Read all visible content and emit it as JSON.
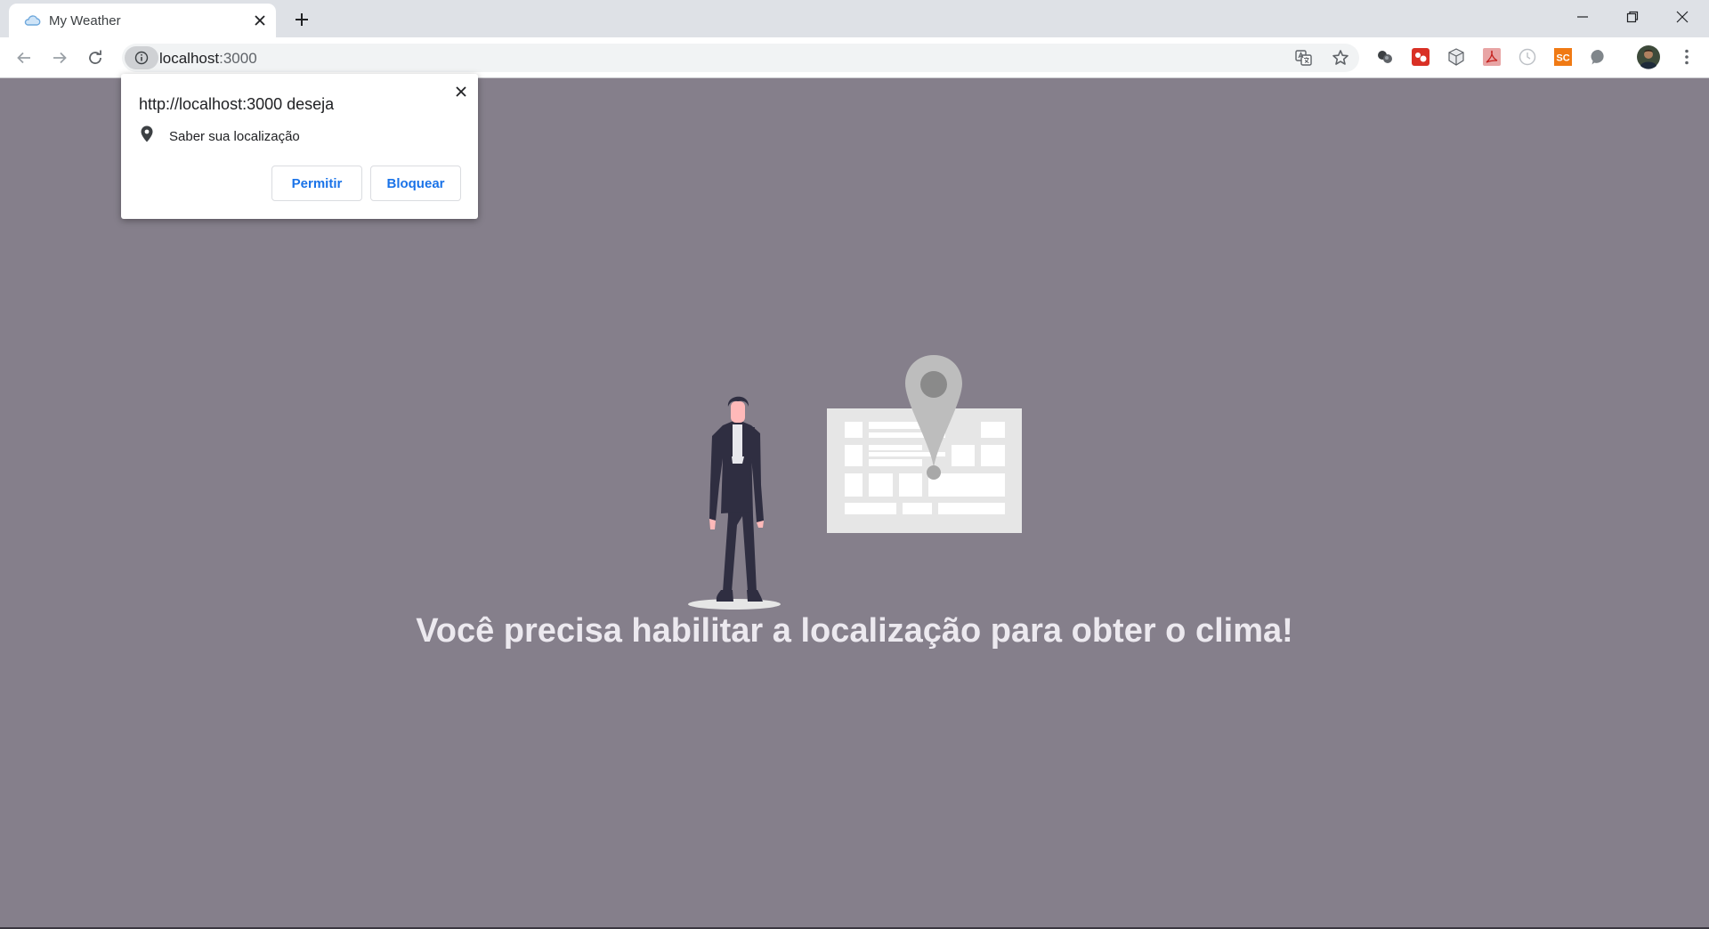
{
  "browser": {
    "tab": {
      "title": "My Weather"
    },
    "address_bar": {
      "host": "localhost",
      "port": ":3000"
    }
  },
  "permission_prompt": {
    "title": "http://localhost:3000 deseja",
    "request": "Saber sua localização",
    "allow_label": "Permitir",
    "block_label": "Bloquear"
  },
  "page": {
    "message": "Você precisa habilitar a localização para obter o clima!"
  },
  "extensions": [
    "ext-bubbles-icon",
    "ext-red-app-icon",
    "ext-cube-icon",
    "ext-pdf-icon",
    "ext-clock-icon",
    "ext-sc-icon",
    "ext-gray-icon"
  ],
  "colors": {
    "page_background": "#857f8b",
    "message_text": "#ece9ef",
    "accent_blue": "#1a73e8",
    "chrome_bg": "#dee1e6"
  }
}
